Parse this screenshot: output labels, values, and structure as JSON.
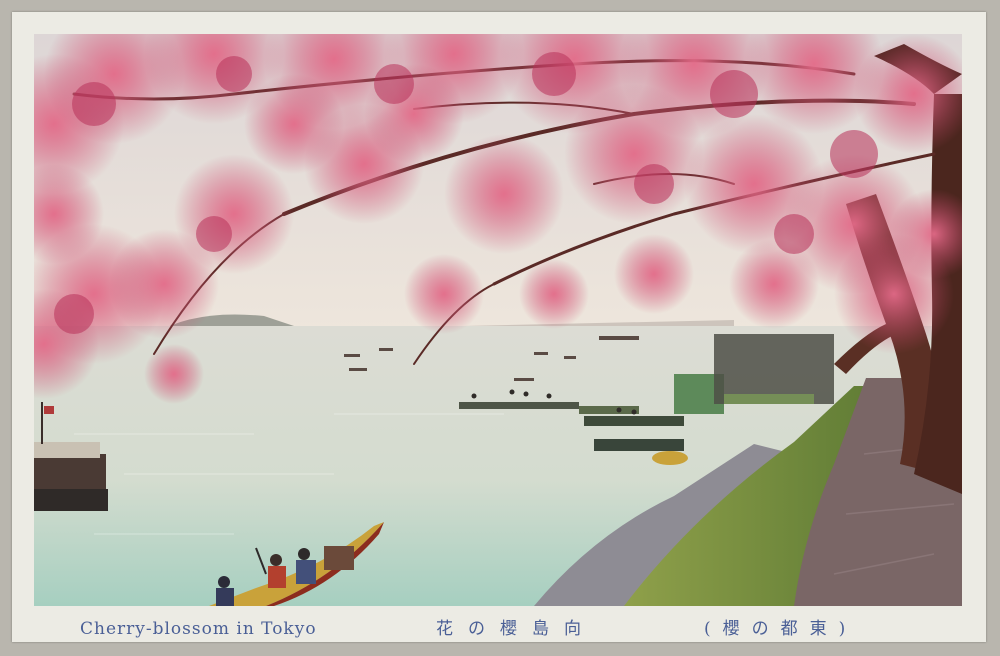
{
  "caption": {
    "english": "Cherry-blossom in Tokyo",
    "japanese_center": "花の櫻島向",
    "japanese_right": "(櫻の都東)"
  },
  "image": {
    "subject": "cherry-blossom-river-scene",
    "palette": {
      "sky": "#e9e3dc",
      "water": "#bcd3c7",
      "blossom": "#d2506f",
      "blossom_dark": "#a83456",
      "trunk": "#5a2f24",
      "grass": "#6f8a3a",
      "path": "#7d6a6b",
      "boat": "#c9a23a",
      "card": "#ecebe4",
      "caption_ink": "#4a5f96"
    }
  }
}
